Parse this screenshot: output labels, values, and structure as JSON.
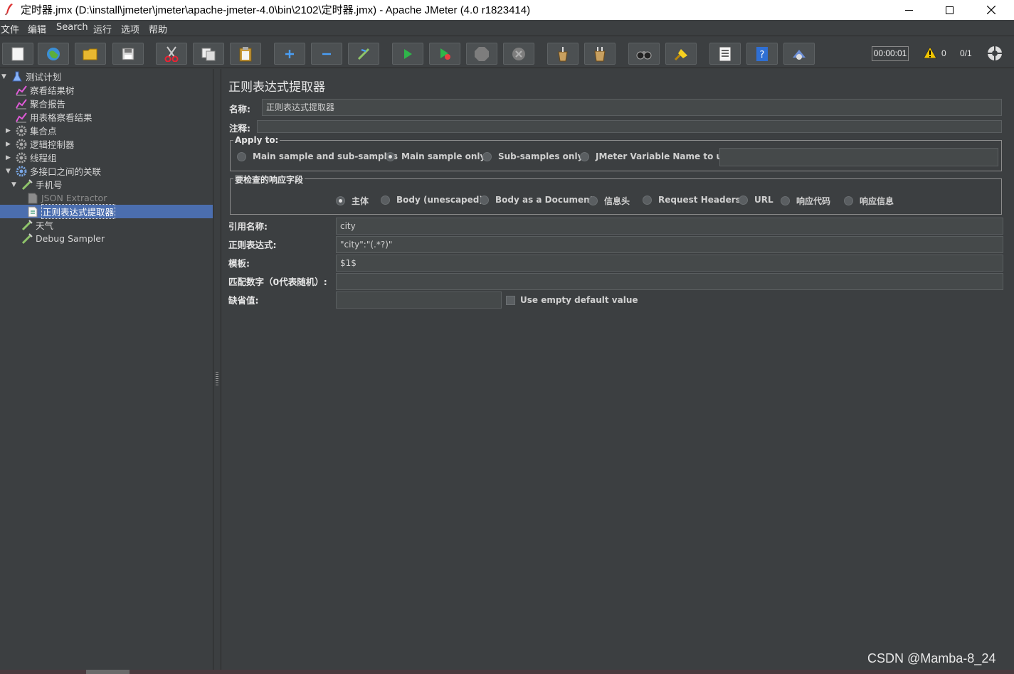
{
  "window": {
    "title": "定时器.jmx (D:\\install\\jmeter\\jmeter\\apache-jmeter-4.0\\bin\\2102\\定时器.jmx) - Apache JMeter (4.0 r1823414)",
    "minimize_icon": "minimize-icon",
    "maximize_icon": "maximize-icon",
    "close_icon": "close-icon"
  },
  "menu": [
    {
      "label": "文件"
    },
    {
      "label": "编辑"
    },
    {
      "label": "Search"
    },
    {
      "label": "运行"
    },
    {
      "label": "选项"
    },
    {
      "label": "帮助"
    }
  ],
  "toolbar": {
    "buttons": [
      {
        "icon": "new-icon"
      },
      {
        "icon": "templates-icon"
      },
      {
        "icon": "open-icon"
      },
      {
        "icon": "save-icon"
      },
      {
        "icon": "cut-icon"
      },
      {
        "icon": "copy-icon"
      },
      {
        "icon": "paste-icon"
      },
      {
        "icon": "expand-icon"
      },
      {
        "icon": "collapse-icon"
      },
      {
        "icon": "toggle-icon"
      },
      {
        "icon": "start-icon"
      },
      {
        "icon": "start-no-pauses-icon"
      },
      {
        "icon": "stop-icon"
      },
      {
        "icon": "shutdown-icon"
      },
      {
        "icon": "clear-icon"
      },
      {
        "icon": "clear-all-icon"
      },
      {
        "icon": "search-icon"
      },
      {
        "icon": "reset-search-icon"
      },
      {
        "icon": "function-helper-icon"
      },
      {
        "icon": "help-icon"
      },
      {
        "icon": "remote-icon"
      }
    ],
    "timer": "00:00:01",
    "warning_count": "0",
    "threads": "0/1",
    "status_icon": "status-icon"
  },
  "tree": [
    {
      "label": "测试计划",
      "icon": "test-plan-icon",
      "arrow": "▼"
    },
    {
      "label": "察看结果树",
      "icon": "listener-icon"
    },
    {
      "label": "聚合报告",
      "icon": "listener-icon"
    },
    {
      "label": "用表格察看结果",
      "icon": "listener-icon"
    },
    {
      "label": "集合点",
      "icon": "gear-icon",
      "arrow": "▶"
    },
    {
      "label": "逻辑控制器",
      "icon": "gear-icon",
      "arrow": "▶"
    },
    {
      "label": "线程组",
      "icon": "gear-icon",
      "arrow": "▶"
    },
    {
      "label": "多接口之间的关联",
      "icon": "gear-icon",
      "arrow": "▼"
    },
    {
      "label": "手机号",
      "icon": "sampler-icon",
      "arrow": "▼"
    },
    {
      "label": "JSON Extractor",
      "icon": "extractor-icon"
    },
    {
      "label": "正则表达式提取器",
      "icon": "extractor-icon"
    },
    {
      "label": "天气",
      "icon": "sampler-icon"
    },
    {
      "label": "Debug Sampler",
      "icon": "sampler-icon"
    }
  ],
  "editor": {
    "heading": "正则表达式提取器",
    "name_label": "名称:",
    "name_value": "正则表达式提取器",
    "comment_label": "注释:",
    "comment_value": "",
    "apply_to": {
      "legend": "Apply to:",
      "options": [
        "Main sample and sub-samples",
        "Main sample only",
        "Sub-samples only",
        "JMeter Variable Name to use"
      ],
      "selected": "Main sample only",
      "variable_value": ""
    },
    "field_to_check": {
      "legend": "要检查的响应字段",
      "options": [
        "主体",
        "Body (unescaped)",
        "Body as a Document",
        "信息头",
        "Request Headers",
        "URL",
        "响应代码",
        "响应信息"
      ],
      "selected": "主体"
    },
    "ref_name_label": "引用名称:",
    "ref_name_value": "city",
    "regex_label": "正则表达式:",
    "regex_value": "\"city\":\"(.*?)\"",
    "template_label": "模板:",
    "template_value": "$1$",
    "match_no_label": "匹配数字（0代表随机）:",
    "match_no_value": "",
    "default_label": "缺省值:",
    "default_value": "",
    "use_empty_label": "Use empty default value",
    "use_empty_checked": false
  },
  "watermark": "CSDN @Mamba-8_24"
}
